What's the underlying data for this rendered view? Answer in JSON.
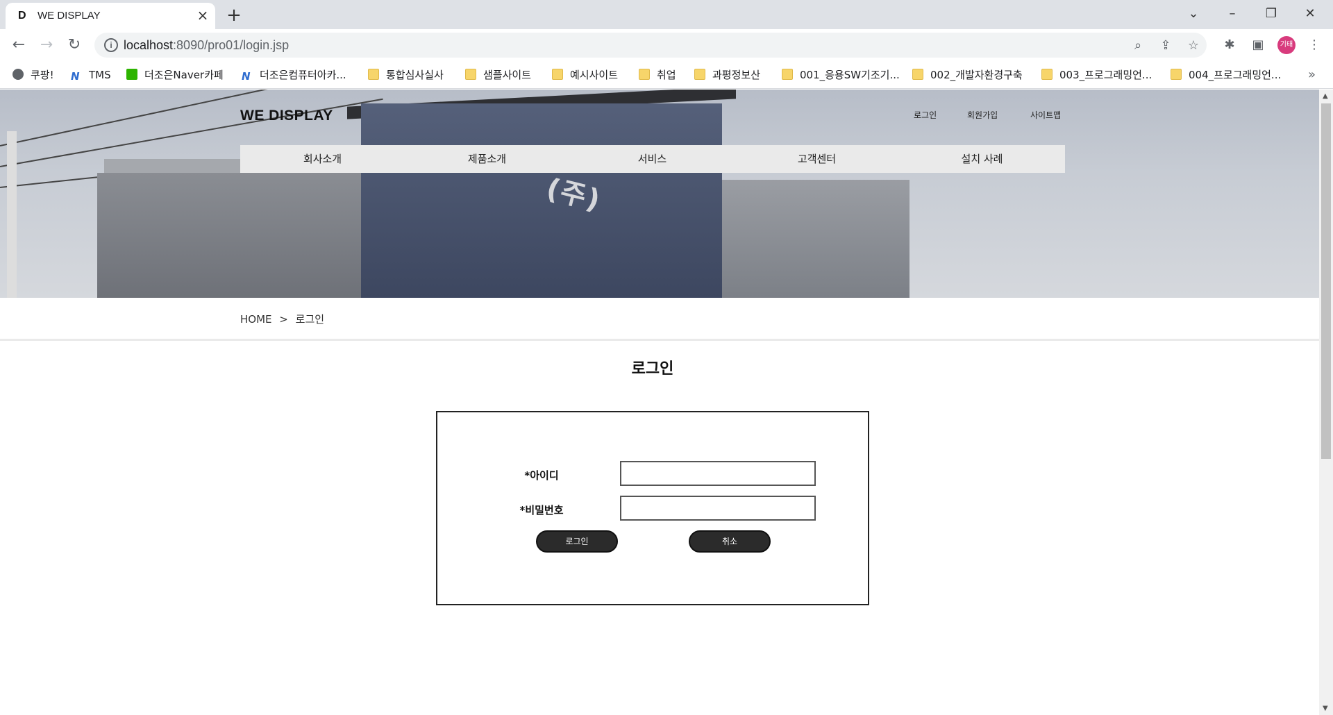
{
  "browser": {
    "tab_title": "WE DISPLAY",
    "tab_favicon": "D",
    "url_host": "localhost",
    "url_rest": ":8090/pro01/login.jsp",
    "profile_label": "기태",
    "bookmarks": [
      {
        "label": "쿠팡!",
        "icon": "globe-icon"
      },
      {
        "label": "TMS",
        "icon": "tms-icon"
      },
      {
        "label": "더조은Naver카페",
        "icon": "naver-cafe-icon"
      },
      {
        "label": "더조은컴퓨터아카...",
        "icon": "academy-icon"
      },
      {
        "label": "통합심사실사",
        "icon": "folder-icon"
      },
      {
        "label": "샘플사이트",
        "icon": "folder-icon"
      },
      {
        "label": "예시사이트",
        "icon": "folder-icon"
      },
      {
        "label": "취업",
        "icon": "folder-icon"
      },
      {
        "label": "과평정보산",
        "icon": "folder-icon"
      },
      {
        "label": "001_응용SW기조기...",
        "icon": "folder-icon"
      },
      {
        "label": "002_개발자환경구축",
        "icon": "folder-icon"
      },
      {
        "label": "003_프로그래밍언...",
        "icon": "folder-icon"
      },
      {
        "label": "004_프로그래밍언...",
        "icon": "folder-icon"
      }
    ]
  },
  "site": {
    "logo": "WE DISPLAY",
    "util_links": [
      "로그인",
      "회원가입",
      "사이트맵"
    ],
    "gnb": [
      "회사소개",
      "제품소개",
      "서비스",
      "고객센터",
      "설치 사례"
    ],
    "hero_sign": "(주)"
  },
  "breadcrumb": {
    "home": "HOME",
    "sep": ">",
    "current": "로그인"
  },
  "page": {
    "title": "로그인",
    "id_label": "*아이디",
    "pw_label": "*비밀번호",
    "id_value": "",
    "pw_value": "",
    "login_button": "로그인",
    "cancel_button": "취소"
  }
}
